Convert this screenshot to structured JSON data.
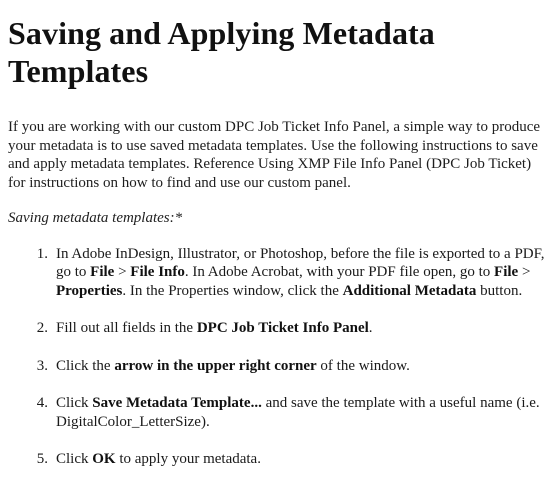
{
  "title": "Saving and Applying Metadata Templates",
  "intro": "If you are working with our custom DPC Job Ticket Info Panel, a simple way to produce your metadata is to use saved metadata templates. Use the following instructions to save and apply metadata templates. Reference Using XMP File Info Panel (DPC Job Ticket) for instructions on how to find and use our custom panel.",
  "subheading": "Saving metadata templates:*",
  "steps": [
    {
      "number": "1.",
      "t1": "In Adobe InDesign, Illustrator, or Photoshop, before the file is exported to a PDF, go to ",
      "b1": "File",
      "t2": " > ",
      "b2": "File Info",
      "t3": ". In Adobe Acrobat, with your PDF file open, go to ",
      "b3": "File",
      "t4": " > ",
      "b4": "Properties",
      "t5": ". In the Properties window, click the ",
      "b5": "Additional Metadata",
      "t6": " button."
    },
    {
      "number": "2.",
      "t1": "Fill out all fields in the ",
      "b1": "DPC Job Ticket Info Panel",
      "t2": "."
    },
    {
      "number": "3.",
      "t1": "Click the ",
      "b1": "arrow in the upper right corner",
      "t2": " of the window."
    },
    {
      "number": "4.",
      "t1": "Click ",
      "b1": "Save Metadata Template...",
      "t2": " and save the template with a useful name (i.e. DigitalColor_LetterSize)."
    },
    {
      "number": "5.",
      "t1": "Click ",
      "b1": "OK",
      "t2": " to apply your metadata."
    }
  ]
}
